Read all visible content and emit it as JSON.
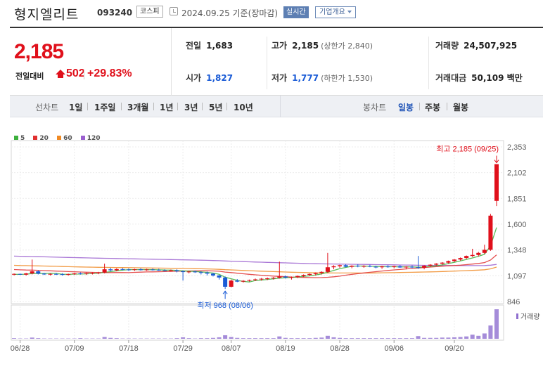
{
  "header": {
    "stock_name": "형지엘리트",
    "stock_code": "093240",
    "market_badge": "코스피",
    "as_of": "2024.09.25 기준(장마감)",
    "realtime_button": "실시간",
    "corp_info_button": "기업개요"
  },
  "quote": {
    "price": "2,185",
    "change_label": "전일대비",
    "change_value": "502",
    "change_pct": "+29.83%",
    "prev_close_label": "전일",
    "prev_close": "1,683",
    "open_label": "시가",
    "open": "1,827",
    "high_label": "고가",
    "high": "2,185",
    "upper_limit": "(상한가 2,840)",
    "low_label": "저가",
    "low": "1,777",
    "lower_limit": "(하한가 1,530)",
    "volume_label": "거래량",
    "volume": "24,507,925",
    "amount_label": "거래대금",
    "amount": "50,109 백만"
  },
  "tabs": {
    "line_chart_label": "선차트",
    "periods": [
      "1일",
      "1주일",
      "3개월",
      "1년",
      "3년",
      "5년",
      "10년"
    ],
    "candle_chart_label": "봉차트",
    "candle_periods": [
      "일봉",
      "주봉",
      "월봉"
    ],
    "active_candle": "일봉"
  },
  "colors": {
    "up": "#e0101b",
    "down": "#1a5bd6",
    "ma5": "#3db03d",
    "ma20": "#e03030",
    "ma60": "#f08a24",
    "ma120": "#9a5fcf",
    "volume": "#8f6fcf"
  },
  "chart_data": {
    "type": "candlestick",
    "legend": [
      "5",
      "20",
      "60",
      "120"
    ],
    "y_ticks": [
      "2,353",
      "2,102",
      "1,851",
      "1,600",
      "1,348",
      "1,097",
      "846"
    ],
    "ylim": [
      846,
      2353
    ],
    "x_ticks": [
      "06/28",
      "07/09",
      "07/18",
      "07/29",
      "08/07",
      "08/19",
      "08/28",
      "09/06",
      "09/20"
    ],
    "volume_label": "거래량",
    "high_annotation": "최고 2,185 (09/25)",
    "low_annotation": "최저 968 (08/06)",
    "candles": [
      [
        1110,
        1120,
        1100,
        1115
      ],
      [
        1115,
        1118,
        1105,
        1108
      ],
      [
        1108,
        1125,
        1100,
        1120
      ],
      [
        1120,
        1255,
        1110,
        1140
      ],
      [
        1140,
        1150,
        1110,
        1118
      ],
      [
        1118,
        1125,
        1105,
        1110
      ],
      [
        1110,
        1120,
        1100,
        1115
      ],
      [
        1115,
        1125,
        1105,
        1112
      ],
      [
        1112,
        1122,
        1100,
        1108
      ],
      [
        1108,
        1118,
        1100,
        1112
      ],
      [
        1112,
        1125,
        1105,
        1120
      ],
      [
        1120,
        1130,
        1108,
        1118
      ],
      [
        1118,
        1128,
        1105,
        1122
      ],
      [
        1122,
        1130,
        1110,
        1125
      ],
      [
        1125,
        1135,
        1112,
        1128
      ],
      [
        1128,
        1215,
        1120,
        1160
      ],
      [
        1160,
        1175,
        1140,
        1150
      ],
      [
        1150,
        1170,
        1140,
        1162
      ],
      [
        1162,
        1172,
        1150,
        1158
      ],
      [
        1158,
        1168,
        1145,
        1155
      ],
      [
        1155,
        1165,
        1145,
        1160
      ],
      [
        1160,
        1170,
        1148,
        1152
      ],
      [
        1152,
        1165,
        1145,
        1158
      ],
      [
        1158,
        1168,
        1148,
        1155
      ],
      [
        1155,
        1165,
        1145,
        1150
      ],
      [
        1150,
        1160,
        1140,
        1148
      ],
      [
        1148,
        1158,
        1138,
        1150
      ],
      [
        1150,
        1160,
        1130,
        1140
      ],
      [
        1140,
        1150,
        1050,
        1135
      ],
      [
        1135,
        1145,
        1120,
        1138
      ],
      [
        1138,
        1148,
        1125,
        1132
      ],
      [
        1132,
        1142,
        1110,
        1128
      ],
      [
        1128,
        1138,
        1100,
        1118
      ],
      [
        1118,
        1125,
        1090,
        1100
      ],
      [
        1100,
        1105,
        1060,
        1080
      ],
      [
        1080,
        1090,
        968,
        990
      ],
      [
        990,
        1060,
        985,
        1050
      ],
      [
        1050,
        1065,
        1035,
        1040
      ],
      [
        1040,
        1055,
        1030,
        1048
      ],
      [
        1048,
        1060,
        1040,
        1055
      ],
      [
        1055,
        1070,
        1045,
        1062
      ],
      [
        1062,
        1075,
        1050,
        1068
      ],
      [
        1068,
        1080,
        1055,
        1072
      ],
      [
        1072,
        1085,
        1060,
        1078
      ],
      [
        1078,
        1235,
        1070,
        1090
      ],
      [
        1090,
        1100,
        1070,
        1080
      ],
      [
        1080,
        1090,
        1060,
        1085
      ],
      [
        1085,
        1100,
        1075,
        1095
      ],
      [
        1095,
        1110,
        1085,
        1105
      ],
      [
        1105,
        1120,
        1095,
        1115
      ],
      [
        1115,
        1130,
        1100,
        1125
      ],
      [
        1125,
        1140,
        1110,
        1135
      ],
      [
        1135,
        1320,
        1125,
        1180
      ],
      [
        1180,
        1200,
        1160,
        1190
      ],
      [
        1190,
        1205,
        1175,
        1200
      ],
      [
        1200,
        1210,
        1180,
        1185
      ],
      [
        1185,
        1200,
        1170,
        1195
      ],
      [
        1195,
        1210,
        1180,
        1188
      ],
      [
        1188,
        1200,
        1175,
        1192
      ],
      [
        1192,
        1205,
        1180,
        1185
      ],
      [
        1185,
        1195,
        1170,
        1180
      ],
      [
        1180,
        1195,
        1165,
        1188
      ],
      [
        1188,
        1200,
        1175,
        1182
      ],
      [
        1182,
        1195,
        1170,
        1190
      ],
      [
        1190,
        1200,
        1175,
        1178
      ],
      [
        1178,
        1190,
        1160,
        1185
      ],
      [
        1185,
        1198,
        1170,
        1180
      ],
      [
        1180,
        1290,
        1165,
        1175
      ],
      [
        1175,
        1200,
        1160,
        1195
      ],
      [
        1195,
        1210,
        1185,
        1205
      ],
      [
        1205,
        1220,
        1195,
        1215
      ],
      [
        1215,
        1230,
        1205,
        1225
      ],
      [
        1225,
        1245,
        1215,
        1240
      ],
      [
        1240,
        1260,
        1230,
        1255
      ],
      [
        1255,
        1275,
        1245,
        1270
      ],
      [
        1270,
        1295,
        1260,
        1290
      ],
      [
        1290,
        1360,
        1280,
        1300
      ],
      [
        1300,
        1330,
        1285,
        1320
      ],
      [
        1320,
        1400,
        1310,
        1350
      ],
      [
        1350,
        1700,
        1340,
        1683
      ],
      [
        1827,
        2185,
        1777,
        2185
      ]
    ],
    "volumes": [
      0.02,
      0.01,
      0.01,
      0.04,
      0.02,
      0.01,
      0.01,
      0.01,
      0.01,
      0.01,
      0.01,
      0.02,
      0.01,
      0.01,
      0.01,
      0.06,
      0.03,
      0.02,
      0.01,
      0.01,
      0.01,
      0.01,
      0.01,
      0.01,
      0.01,
      0.01,
      0.01,
      0.02,
      0.05,
      0.02,
      0.01,
      0.02,
      0.02,
      0.03,
      0.05,
      0.12,
      0.06,
      0.03,
      0.02,
      0.02,
      0.02,
      0.02,
      0.02,
      0.02,
      0.08,
      0.03,
      0.02,
      0.02,
      0.02,
      0.02,
      0.03,
      0.04,
      0.1,
      0.05,
      0.03,
      0.02,
      0.02,
      0.02,
      0.02,
      0.02,
      0.02,
      0.02,
      0.02,
      0.02,
      0.02,
      0.02,
      0.02,
      0.09,
      0.03,
      0.03,
      0.03,
      0.04,
      0.04,
      0.05,
      0.06,
      0.08,
      0.14,
      0.1,
      0.18,
      0.45,
      1.0
    ]
  }
}
